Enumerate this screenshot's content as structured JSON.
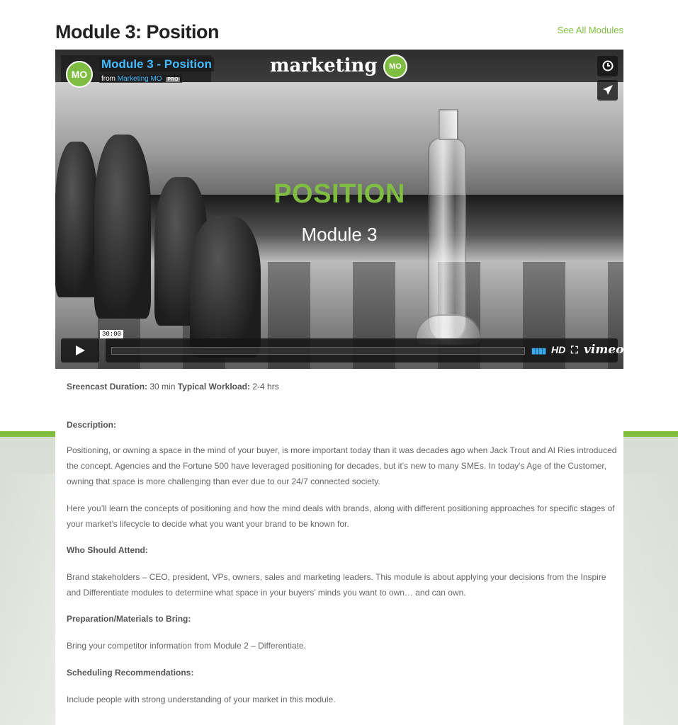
{
  "header": {
    "title": "Module 3: Position",
    "see_all": "See All Modules"
  },
  "video": {
    "title": "Module 3 - Position",
    "from": "from",
    "owner": "Marketing MO",
    "owner_badge": "PRO",
    "avatar_text": "MO",
    "brand": "marketing",
    "brand_badge": "MO",
    "overlay_title": "POSITION",
    "overlay_subtitle": "Module 3",
    "time_label": "30:00",
    "hd_label": "HD",
    "vimeo_label": "vimeo",
    "icons": {
      "watch_later": "clock-icon",
      "share": "send-icon",
      "play": "play-icon",
      "volume": "volume-icon",
      "fullscreen": "fullscreen-icon"
    }
  },
  "meta": {
    "duration_label": "Sreencast Duration:",
    "duration_value": "30 min",
    "workload_label": "Typical Workload:",
    "workload_value": "2-4 hrs"
  },
  "sections": {
    "description_head": "Description:",
    "description_p1": "Positioning, or owning a space in the mind of your buyer, is more important today than it was decades ago when Jack Trout and Al Ries introduced the concept. Agencies and the Fortune 500 have leveraged positioning for decades, but it’s new to many SMEs. In today’s Age of the Customer, owning that space is more challenging than ever due to our 24/7 connected society.",
    "description_p2": "Here you’ll learn the concepts of positioning and how the mind deals with brands, along with different positioning approaches for specific stages of your market’s lifecycle to decide what you want your brand to be known for.",
    "who_head": "Who Should Attend:",
    "who_p": "Brand stakeholders – CEO, president, VPs, owners, sales and marketing leaders. This module is about applying your decisions from the Inspire and Differentiate modules to determine what space in your buyers’ minds you want to own… and can own.",
    "prep_head": "Preparation/Materials to Bring:",
    "prep_p": "Bring your competitor information from Module 2 – Differentiate.",
    "sched_head": "Scheduling Recommendations:",
    "sched_p": "Include people with strong understanding of your market in this module."
  },
  "colors": {
    "accent_green": "#7fbc42",
    "vimeo_blue": "#44bbff"
  }
}
